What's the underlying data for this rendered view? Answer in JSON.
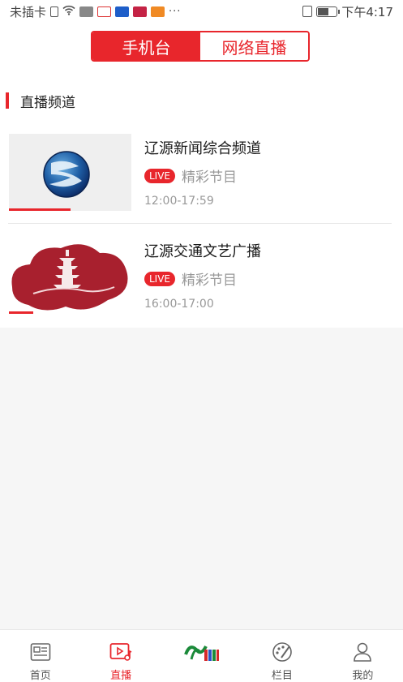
{
  "status_bar": {
    "carrier": "未插卡",
    "more": "···",
    "time": "下午4:17",
    "battery_level": 0.6
  },
  "header": {
    "tabs": [
      {
        "label": "手机台",
        "active": true
      },
      {
        "label": "网络直播",
        "active": false
      }
    ]
  },
  "section": {
    "title": "直播频道"
  },
  "channels": [
    {
      "name": "辽源新闻综合频道",
      "badge": "LIVE",
      "program": "精彩节目",
      "time": "12:00-17:59",
      "progress": 0.5
    },
    {
      "name": "辽源交通文艺广播",
      "badge": "LIVE",
      "program": "精彩节目",
      "time": "16:00-17:00",
      "progress": 0.2
    }
  ],
  "bottom_nav": {
    "items": [
      {
        "label": "首页",
        "icon": "news-icon",
        "active": false
      },
      {
        "label": "直播",
        "icon": "live-play-icon",
        "active": true
      },
      {
        "label": "",
        "icon": "station-logo",
        "active": false
      },
      {
        "label": "栏目",
        "icon": "palette-icon",
        "active": false
      },
      {
        "label": "我的",
        "icon": "user-icon",
        "active": false
      }
    ]
  },
  "colors": {
    "accent": "#e8262c",
    "muted": "#999999"
  }
}
